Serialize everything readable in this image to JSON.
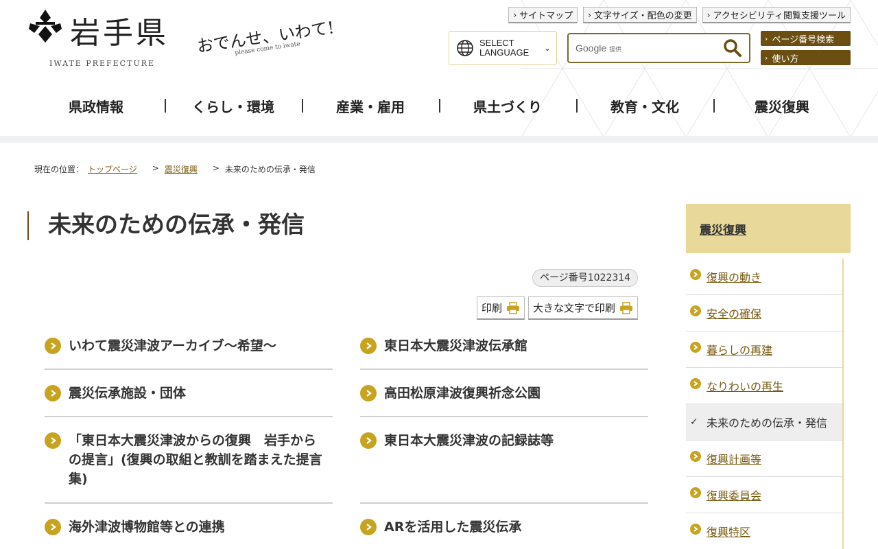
{
  "header": {
    "logo_name": "岩手県",
    "logo_sub": "IWATE PREFECTURE",
    "catch_main": "おでんせ、いわて!",
    "catch_sub": "please come to iwate",
    "top_links": [
      "サイトマップ",
      "文字サイズ・配色の変更",
      "アクセシビリティ閲覧支援ツール"
    ],
    "lang_line1": "SELECT",
    "lang_line2": "LANGUAGE",
    "search_brand": "Google",
    "search_brand_note": "提供",
    "side_buttons": [
      "ページ番号検索",
      "使い方"
    ]
  },
  "gnav": [
    "県政情報",
    "くらし・環境",
    "産業・雇用",
    "県土づくり",
    "教育・文化",
    "震災復興"
  ],
  "breadcrumb": {
    "prefix": "現在の位置：",
    "items": [
      "トップページ",
      "震災復興"
    ],
    "current": "未来のための伝承・発信"
  },
  "page": {
    "title": "未来のための伝承・発信",
    "page_number": "ページ番号1022314",
    "print_label": "印刷",
    "print_large_label": "大きな文字で印刷"
  },
  "links": [
    "いわて震災津波アーカイブ～希望～",
    "東日本大震災津波伝承館",
    "震災伝承施設・団体",
    "高田松原津波復興祈念公園",
    "「東日本大震災津波からの復興　岩手からの提言」(復興の取組と教訓を踏まえた提言集)",
    "東日本大震災津波の記録誌等",
    "海外津波博物館等との連携",
    "ARを活用した震災伝承"
  ],
  "sidebar": {
    "heading": "震災復興",
    "items": [
      "復興の動き",
      "安全の確保",
      "暮らしの再建",
      "なりわいの再生",
      "未来のための伝承・発信",
      "復興計画等",
      "復興委員会",
      "復興特区"
    ],
    "current_index": 4
  },
  "colors": {
    "accent_gold": "#c8a320",
    "dark_brown": "#6a4e12",
    "link_brown": "#7a5b12",
    "sidebar_gold": "#e8d89a"
  }
}
